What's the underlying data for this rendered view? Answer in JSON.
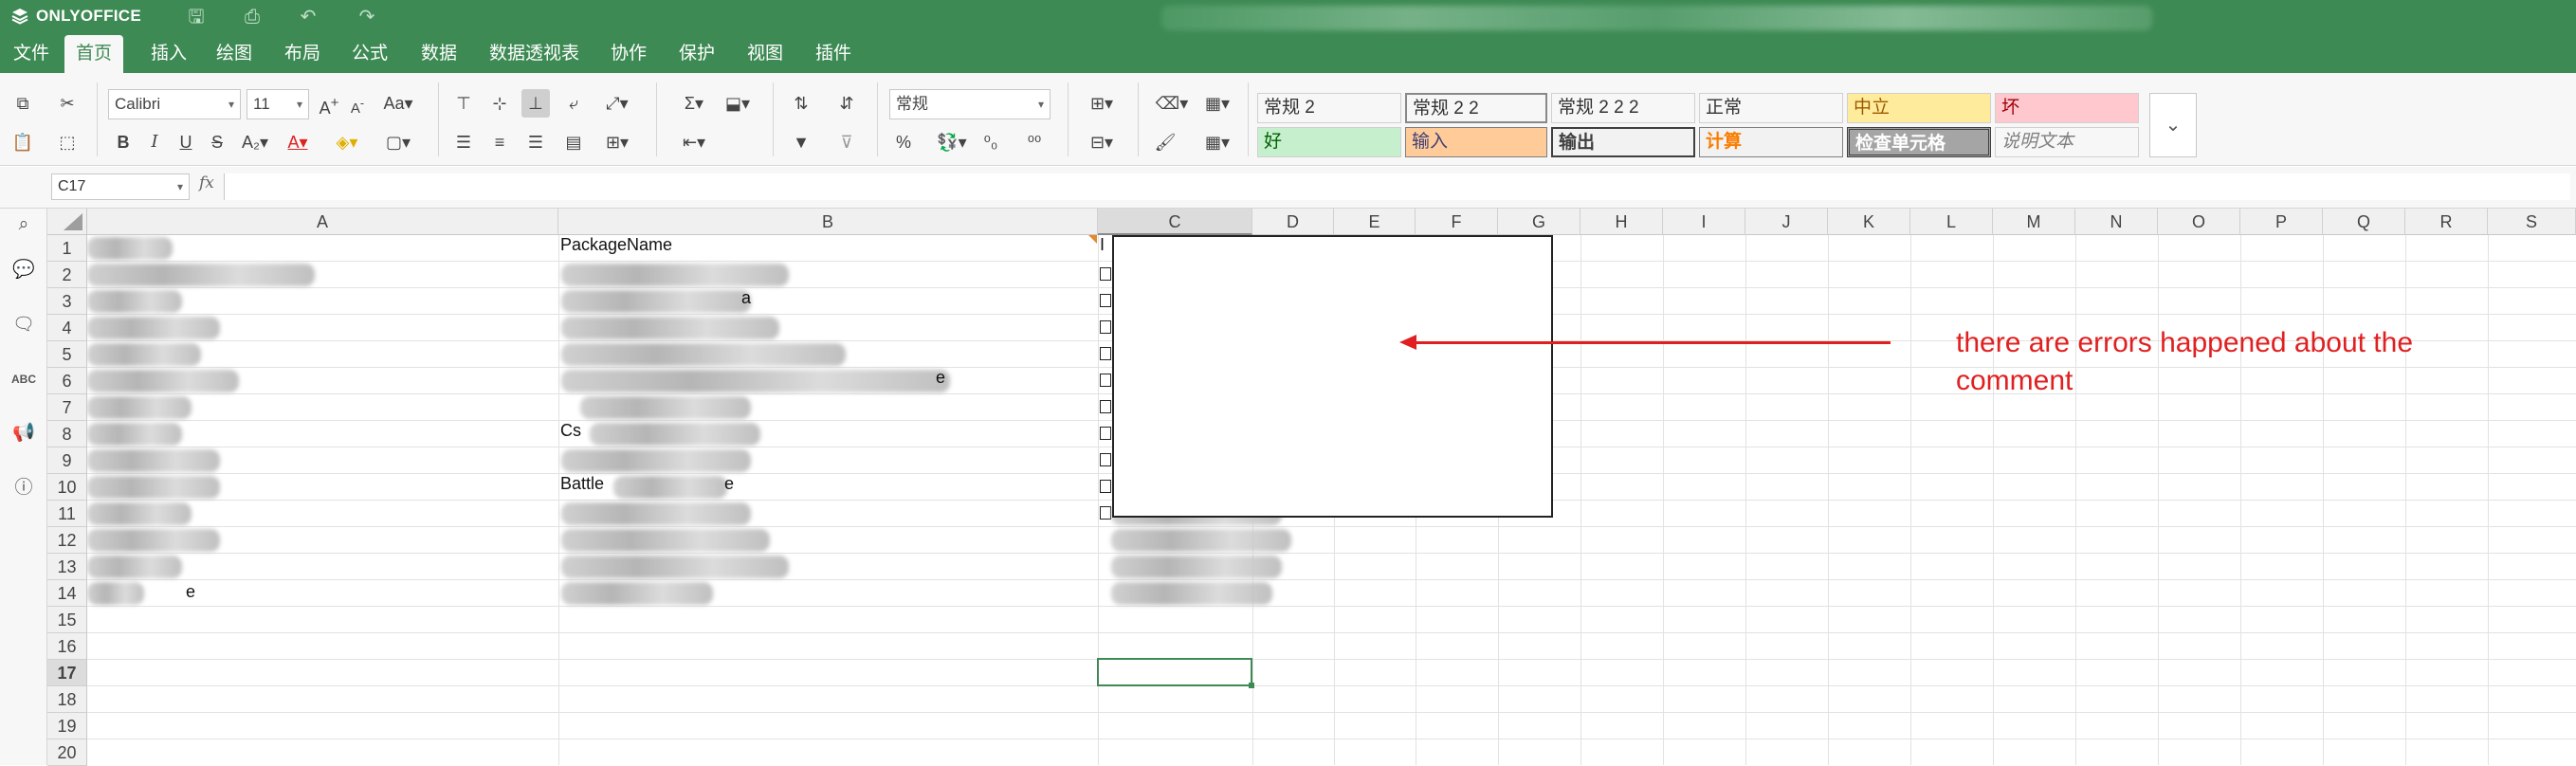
{
  "app": {
    "brand": "ONLYOFFICE"
  },
  "titlebar_icons": [
    "save-icon",
    "print-icon",
    "undo-icon",
    "redo-icon"
  ],
  "menu": [
    "文件",
    "首页",
    "插入",
    "绘图",
    "布局",
    "公式",
    "数据",
    "数据透视表",
    "协作",
    "保护",
    "视图",
    "插件"
  ],
  "active_menu": "首页",
  "ribbon": {
    "font_name": "Calibri",
    "font_size": "11",
    "number_format": "常规",
    "bold": "B",
    "italic": "I",
    "underline": "U",
    "strike": "S",
    "percent": "%"
  },
  "styles": [
    {
      "label": "常规 2",
      "bg": "#ffffff",
      "color": "#222222"
    },
    {
      "label": "常规 2 2",
      "bg": "#ffffff",
      "color": "#222222"
    },
    {
      "label": "常规 2 2 2",
      "bg": "#ffffff",
      "color": "#222222"
    },
    {
      "label": "正常",
      "bg": "#ffffff",
      "color": "#222222"
    },
    {
      "label": "中立",
      "bg": "#ffeb9c",
      "color": "#9c5700"
    },
    {
      "label": "坏",
      "bg": "#ffc7ce",
      "color": "#9c0006"
    },
    {
      "label": "好",
      "bg": "#c6efce",
      "color": "#006100"
    },
    {
      "label": "输入",
      "bg": "#ffcc99",
      "color": "#3f3f76"
    },
    {
      "label": "输出",
      "bg": "#f2f2f2",
      "color": "#3f3f3f"
    },
    {
      "label": "计算",
      "bg": "#f2f2f2",
      "color": "#fa7d00"
    },
    {
      "label": "检查单元格",
      "bg": "#a5a5a5",
      "color": "#ffffff"
    },
    {
      "label": "说明文本",
      "bg": "#ffffff",
      "color": "#7f7f7f"
    }
  ],
  "formula_bar": {
    "name_box": "C17",
    "fx": "fx",
    "value": ""
  },
  "columns": [
    "A",
    "B",
    "C",
    "D",
    "E",
    "F",
    "G",
    "H",
    "I",
    "J",
    "K",
    "L",
    "M",
    "N",
    "O",
    "P",
    "Q",
    "R",
    "S"
  ],
  "selected_column": "C",
  "rows": [
    "1",
    "2",
    "3",
    "4",
    "5",
    "6",
    "7",
    "8",
    "9",
    "10",
    "11",
    "12",
    "13",
    "14",
    "15",
    "16",
    "17",
    "18",
    "19",
    "20"
  ],
  "selected_row": "17",
  "cells": {
    "B1": "PackageName",
    "B3_tail": "a",
    "B6_tail": "e",
    "B8_head": "Cs",
    "B10_head": "Battle",
    "B10_tail": "e",
    "A14_tail": "e",
    "C1_head": "I"
  },
  "annotation": {
    "line1": "there are errors happened about the",
    "line2": "comment",
    "color": "#e02020"
  },
  "colors": {
    "brand_green": "#3e8a54"
  }
}
